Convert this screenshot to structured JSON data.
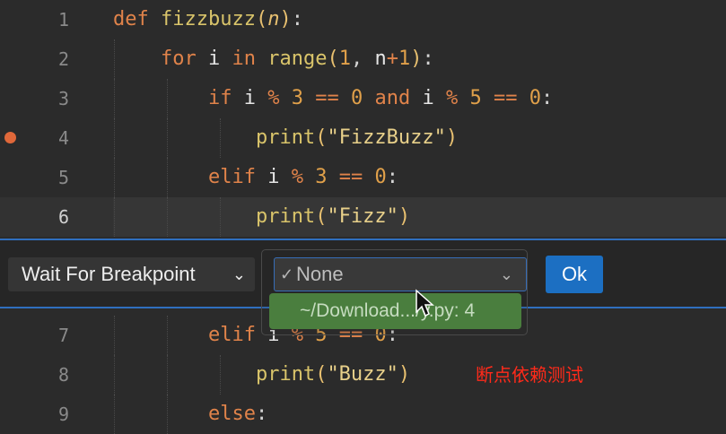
{
  "editor": {
    "function_name": "fizzbuzz",
    "param": "n",
    "lines": [
      {
        "num": "1"
      },
      {
        "num": "2"
      },
      {
        "num": "3"
      },
      {
        "num": "4"
      },
      {
        "num": "5"
      },
      {
        "num": "6"
      },
      {
        "num": "7"
      },
      {
        "num": "8"
      },
      {
        "num": "9"
      }
    ],
    "breakpoint_line": "4",
    "current_line": "6"
  },
  "code": {
    "def": "def",
    "for": "for",
    "in": "in",
    "range": "range",
    "if": "if",
    "and": "and",
    "elif": "elif",
    "else": "else",
    "print": "print",
    "s_fizzbuzz": "\"FizzBuzz\"",
    "s_fizz": "\"Fizz\"",
    "s_buzz": "\"Buzz\""
  },
  "widget": {
    "mode_label": "Wait For Breakpoint",
    "selected_value": "None",
    "ok_label": "Ok",
    "dropdown_item": "~/Download.../y.py: 4"
  },
  "annotation": "断点依赖测试",
  "colors": {
    "accent": "#2f6fbf",
    "ok_button": "#1c6fc2",
    "breakpoint": "#e0683a",
    "dropdown_highlight": "#4a7e3e",
    "annotation": "#ff2a1a"
  }
}
